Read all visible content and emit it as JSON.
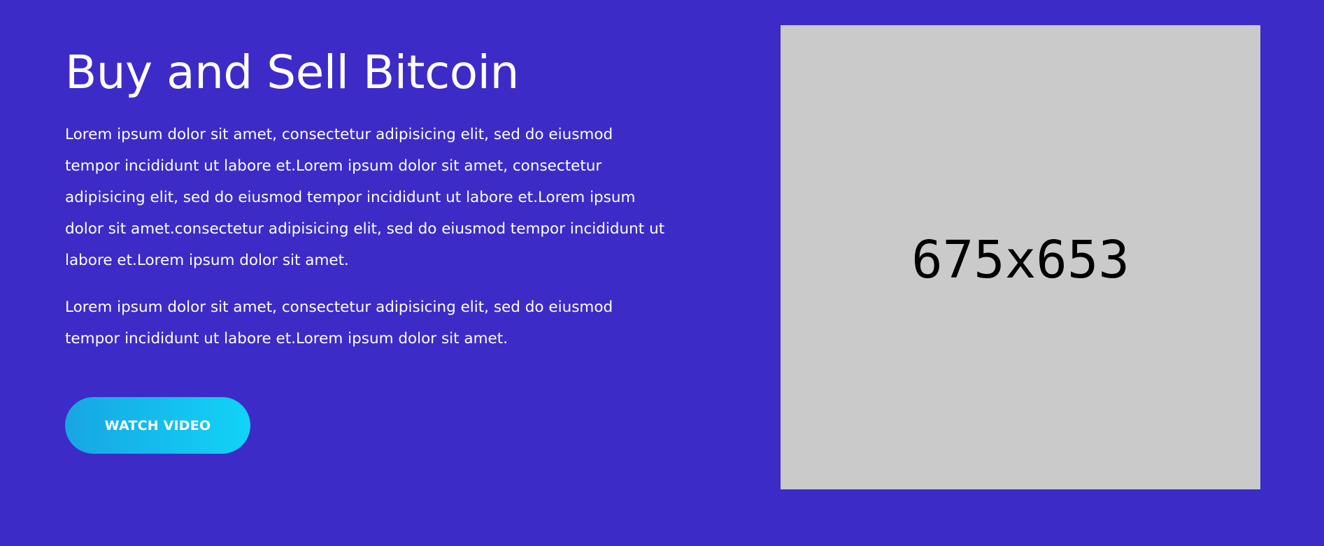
{
  "hero": {
    "title": "Buy and Sell Bitcoin",
    "paragraph_1": "Lorem ipsum dolor sit amet, consectetur adipisicing elit, sed do eiusmod tempor incididunt ut labore et.Lorem ipsum dolor sit amet, consectetur adipisicing elit, sed do eiusmod tempor incididunt ut labore et.Lorem ipsum dolor sit amet.consectetur adipisicing elit, sed do eiusmod tempor incididunt ut labore et.Lorem ipsum dolor sit amet.",
    "paragraph_2": "Lorem ipsum dolor sit amet, consectetur adipisicing elit, sed do eiusmod tempor incididunt ut labore et.Lorem ipsum dolor sit amet.",
    "cta_label": "WATCH VIDEO"
  },
  "image_placeholder": {
    "label": "675x653"
  },
  "colors": {
    "background": "#3d2bc7",
    "text": "#ffffff",
    "button_gradient_start": "#17a6e3",
    "button_gradient_end": "#12d3f7",
    "placeholder_bg": "#cacaca"
  }
}
